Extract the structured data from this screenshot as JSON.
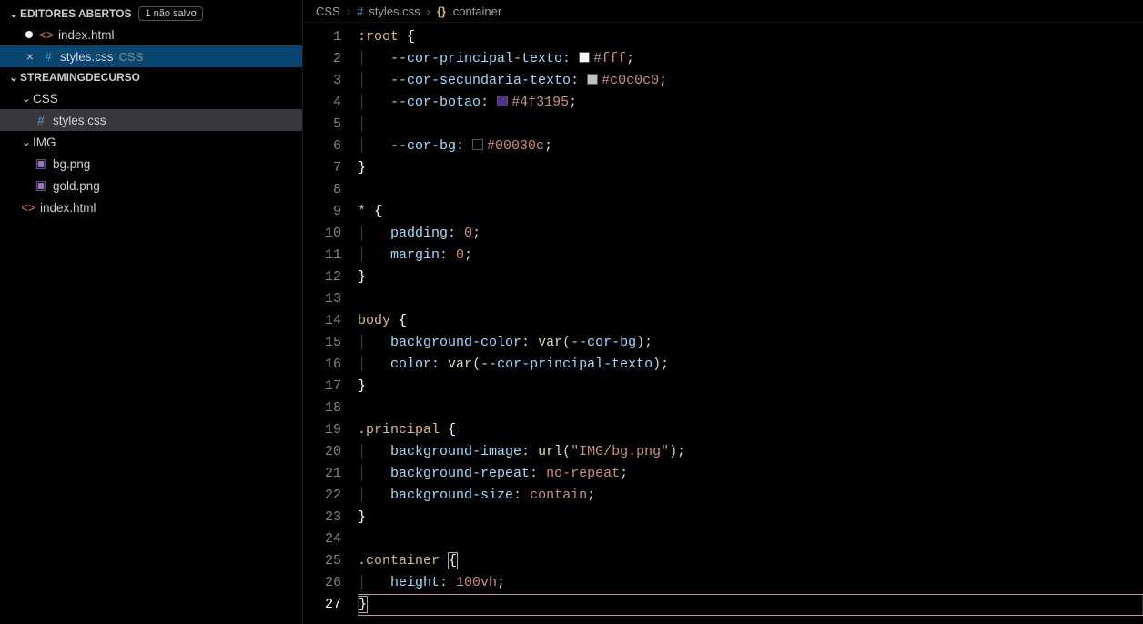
{
  "sidebar": {
    "openEditors": {
      "title": "EDITORES ABERTOS",
      "badge": "1 não salvo",
      "items": [
        {
          "name": "index.html",
          "icon": "html",
          "modified": true
        },
        {
          "name": "styles.css",
          "desc": "CSS",
          "icon": "css",
          "closeable": true
        }
      ]
    },
    "project": {
      "title": "STREAMINGDECURSO",
      "tree": [
        {
          "type": "folder",
          "name": "CSS",
          "depth": 1,
          "open": true
        },
        {
          "type": "file",
          "name": "styles.css",
          "icon": "css",
          "depth": 2,
          "active": true
        },
        {
          "type": "folder",
          "name": "IMG",
          "depth": 1,
          "open": true
        },
        {
          "type": "file",
          "name": "bg.png",
          "icon": "img",
          "depth": 2
        },
        {
          "type": "file",
          "name": "gold.png",
          "icon": "img",
          "depth": 2
        },
        {
          "type": "file",
          "name": "index.html",
          "icon": "html",
          "depth": 1
        }
      ]
    }
  },
  "breadcrumbs": [
    {
      "label": "CSS"
    },
    {
      "label": "styles.css",
      "icon": "css"
    },
    {
      "label": ".container",
      "icon": "bracket"
    }
  ],
  "editor": {
    "activeLine": 27,
    "lines": [
      {
        "n": 1,
        "tokens": [
          [
            "sel",
            ":root "
          ],
          [
            "brace",
            "{"
          ]
        ]
      },
      {
        "n": 2,
        "tokens": [
          [
            "guide",
            "│   "
          ],
          [
            "prop",
            "--cor-principal-texto"
          ],
          [
            "punct",
            ": "
          ],
          [
            "swatch",
            "#ffffff"
          ],
          [
            "val",
            "#fff"
          ],
          [
            "punct",
            ";"
          ]
        ]
      },
      {
        "n": 3,
        "tokens": [
          [
            "guide",
            "│   "
          ],
          [
            "prop",
            "--cor-secundaria-texto"
          ],
          [
            "punct",
            ": "
          ],
          [
            "swatch",
            "#c0c0c0"
          ],
          [
            "val",
            "#c0c0c0"
          ],
          [
            "punct",
            ";"
          ]
        ]
      },
      {
        "n": 4,
        "tokens": [
          [
            "guide",
            "│   "
          ],
          [
            "prop",
            "--cor-botao"
          ],
          [
            "punct",
            ": "
          ],
          [
            "swatch",
            "#4f3195"
          ],
          [
            "val",
            "#4f3195"
          ],
          [
            "punct",
            ";"
          ]
        ]
      },
      {
        "n": 5,
        "tokens": [
          [
            "guide",
            "│"
          ]
        ]
      },
      {
        "n": 6,
        "tokens": [
          [
            "guide",
            "│   "
          ],
          [
            "prop",
            "--cor-bg"
          ],
          [
            "punct",
            ": "
          ],
          [
            "swatch",
            "#00030c"
          ],
          [
            "val",
            "#00030c"
          ],
          [
            "punct",
            ";"
          ]
        ]
      },
      {
        "n": 7,
        "tokens": [
          [
            "brace",
            "}"
          ]
        ]
      },
      {
        "n": 8,
        "tokens": []
      },
      {
        "n": 9,
        "tokens": [
          [
            "sel",
            "* "
          ],
          [
            "brace",
            "{"
          ]
        ]
      },
      {
        "n": 10,
        "tokens": [
          [
            "guide",
            "│   "
          ],
          [
            "prop",
            "padding"
          ],
          [
            "punct",
            ": "
          ],
          [
            "val",
            "0"
          ],
          [
            "punct",
            ";"
          ]
        ]
      },
      {
        "n": 11,
        "tokens": [
          [
            "guide",
            "│   "
          ],
          [
            "prop",
            "margin"
          ],
          [
            "punct",
            ": "
          ],
          [
            "val",
            "0"
          ],
          [
            "punct",
            ";"
          ]
        ]
      },
      {
        "n": 12,
        "tokens": [
          [
            "brace",
            "}"
          ]
        ]
      },
      {
        "n": 13,
        "tokens": []
      },
      {
        "n": 14,
        "tokens": [
          [
            "sel",
            "body "
          ],
          [
            "brace",
            "{"
          ]
        ]
      },
      {
        "n": 15,
        "tokens": [
          [
            "guide",
            "│   "
          ],
          [
            "prop",
            "background-color"
          ],
          [
            "punct",
            ": "
          ],
          [
            "func",
            "var"
          ],
          [
            "punct",
            "("
          ],
          [
            "var",
            "--cor-bg"
          ],
          [
            "punct",
            ");"
          ]
        ]
      },
      {
        "n": 16,
        "tokens": [
          [
            "guide",
            "│   "
          ],
          [
            "prop",
            "color"
          ],
          [
            "punct",
            ": "
          ],
          [
            "func",
            "var"
          ],
          [
            "punct",
            "("
          ],
          [
            "var",
            "--cor-principal-texto"
          ],
          [
            "punct",
            ");"
          ]
        ]
      },
      {
        "n": 17,
        "tokens": [
          [
            "brace",
            "}"
          ]
        ]
      },
      {
        "n": 18,
        "tokens": []
      },
      {
        "n": 19,
        "tokens": [
          [
            "sel",
            ".principal "
          ],
          [
            "brace",
            "{"
          ]
        ]
      },
      {
        "n": 20,
        "tokens": [
          [
            "guide",
            "│   "
          ],
          [
            "prop",
            "background-image"
          ],
          [
            "punct",
            ": "
          ],
          [
            "func",
            "url"
          ],
          [
            "punct",
            "("
          ],
          [
            "val",
            "\"IMG/bg.png\""
          ],
          [
            "punct",
            ");"
          ]
        ]
      },
      {
        "n": 21,
        "tokens": [
          [
            "guide",
            "│   "
          ],
          [
            "prop",
            "background-repeat"
          ],
          [
            "punct",
            ": "
          ],
          [
            "val",
            "no-repeat"
          ],
          [
            "punct",
            ";"
          ]
        ]
      },
      {
        "n": 22,
        "tokens": [
          [
            "guide",
            "│   "
          ],
          [
            "prop",
            "background-size"
          ],
          [
            "punct",
            ": "
          ],
          [
            "val",
            "contain"
          ],
          [
            "punct",
            ";"
          ]
        ]
      },
      {
        "n": 23,
        "tokens": [
          [
            "brace",
            "}"
          ]
        ]
      },
      {
        "n": 24,
        "tokens": []
      },
      {
        "n": 25,
        "tokens": [
          [
            "sel",
            ".container "
          ],
          [
            "cursorbox-open",
            ""
          ],
          [
            "brace",
            "{"
          ],
          [
            "cursorbox-close",
            ""
          ]
        ]
      },
      {
        "n": 26,
        "tokens": [
          [
            "guide",
            "│   "
          ],
          [
            "prop",
            "height"
          ],
          [
            "punct",
            ": "
          ],
          [
            "val",
            "100vh"
          ],
          [
            "punct",
            ";"
          ]
        ]
      },
      {
        "n": 27,
        "tokens": [
          [
            "cursorbox-open",
            ""
          ],
          [
            "brace",
            "}"
          ],
          [
            "cursorbox-close",
            ""
          ]
        ],
        "current": true
      }
    ]
  }
}
